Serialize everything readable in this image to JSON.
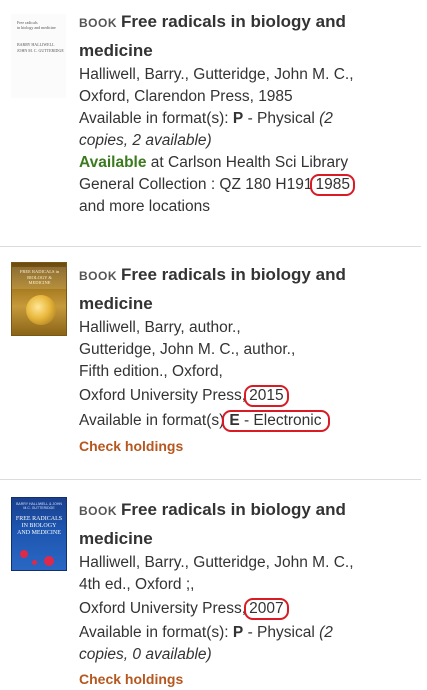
{
  "results": [
    {
      "type_label": "BOOK",
      "title_line1": "Free radicals in biology and",
      "title_line2": "medicine",
      "authors_line1": "Halliwell, Barry., Gutteridge, John M. C.,",
      "pub_line": "Oxford, Clarendon Press, 1985",
      "format_prefix": "Available in format(s): ",
      "format_code": "P",
      "format_desc": " - Physical ",
      "copies_a": "(2",
      "copies_b": "copies, 2 available)",
      "available_word": "Available",
      "location": " at Carlson Health Sci Library",
      "collection_prefix": "General Collection : QZ 180 H191",
      "collection_year": "1985",
      "more_locations": "and more locations",
      "thumb_lines": [
        "Free radicals",
        "in biology and medicine",
        "BARRY HALLIWELL",
        "JOHN M. C. GUTTERIDGE"
      ]
    },
    {
      "type_label": "BOOK",
      "title_line1": "Free radicals in biology and",
      "title_line2": "medicine",
      "authors_line1": "Halliwell, Barry, author.,",
      "authors_line2": "Gutteridge, John M. C., author.,",
      "edition_line": "Fifth edition., Oxford,",
      "pub_prefix": "Oxford University Press,",
      "pub_year": "2015",
      "format_prefix": "Available in format(s)",
      "format_code": "E",
      "format_desc": " - Electronic",
      "check_holdings": "Check holdings",
      "thumb_lines": [
        "FREE RADICALS in",
        "BIOLOGY & MEDICINE"
      ]
    },
    {
      "type_label": "BOOK",
      "title_line1": "Free radicals in biology and",
      "title_line2": "medicine",
      "authors_line1": "Halliwell, Barry., Gutteridge, John M. C.,",
      "edition_line": "4th ed., Oxford ;,",
      "pub_prefix": "Oxford University Press,",
      "pub_year": "2007",
      "format_prefix": "Available in format(s): ",
      "format_code": "P",
      "format_desc": " - Physical ",
      "copies_a": "(2",
      "copies_b": "copies, 0 available)",
      "check_holdings": "Check holdings",
      "thumb_top": "BARRY HALLIWELL & JOHN M.C. GUTTERIDGE",
      "thumb_lines": [
        "FREE RADICALS",
        "IN BIOLOGY",
        "AND MEDICINE"
      ]
    }
  ],
  "colors": {
    "text": "#333333",
    "available": "#3c7a1e",
    "link": "#b5571f",
    "highlight_circle": "#d81b25"
  }
}
